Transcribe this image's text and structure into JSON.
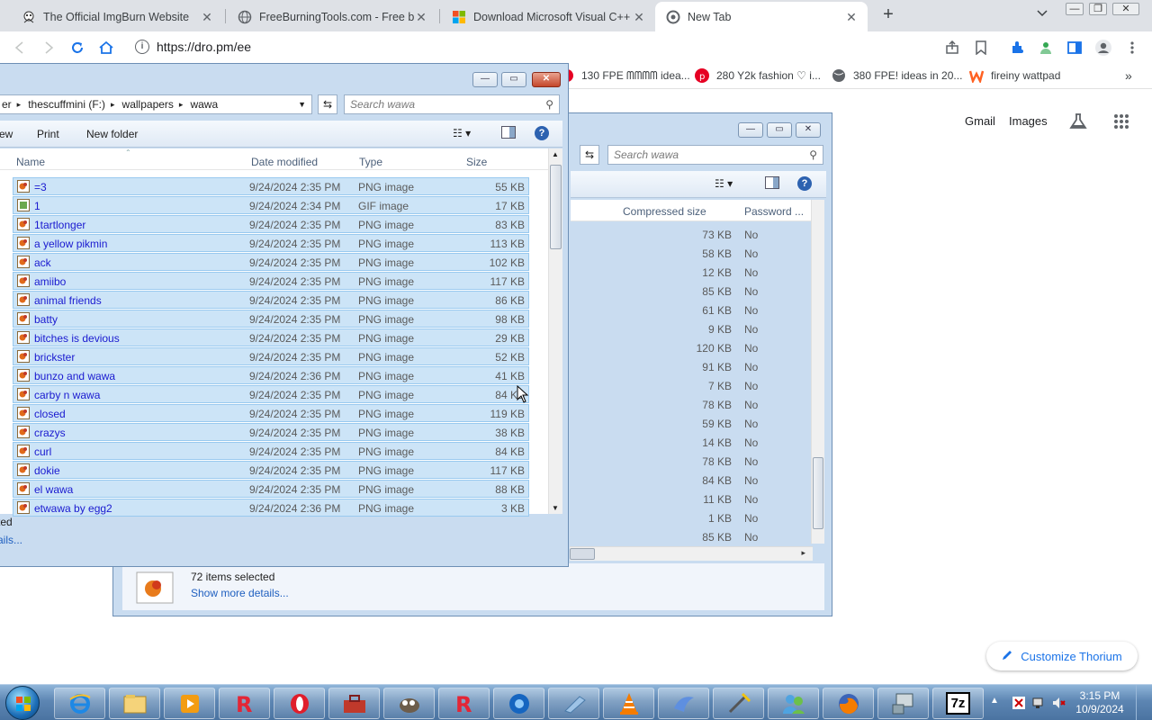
{
  "browser": {
    "tabs": [
      {
        "title": "The Official ImgBurn Website",
        "active": false
      },
      {
        "title": "FreeBurningTools.com - Free bur",
        "active": false
      },
      {
        "title": "Download Microsoft Visual C++",
        "active": false
      },
      {
        "title": "New Tab",
        "active": true
      }
    ],
    "new_tab_label": "+",
    "url": "https://dro.pm/ee",
    "bookmarks": [
      "130 FPE ᗰᗰᗰᗰ idea...",
      "280 Y2k fashion ♡ i...",
      "380 FPE! ideas in 20...",
      "fireiny wattpad"
    ]
  },
  "google": {
    "gmail_label": "Gmail",
    "images_label": "Images",
    "customize_label": "Customize Thorium"
  },
  "explorer_front": {
    "breadcrumb": [
      "er",
      "thescuffmini (F:)",
      "wallpapers",
      "wawa"
    ],
    "search_placeholder": "Search wawa",
    "toolbar": {
      "view_label": "ew",
      "print_label": "Print",
      "new_folder_label": "New folder"
    },
    "columns": {
      "name": "Name",
      "date": "Date modified",
      "type": "Type",
      "size": "Size"
    },
    "rows": [
      {
        "name": "=3",
        "date": "9/24/2024 2:35 PM",
        "type": "PNG image",
        "size": "55 KB"
      },
      {
        "name": "1",
        "date": "9/24/2024 2:34 PM",
        "type": "GIF image",
        "size": "17 KB"
      },
      {
        "name": "1tartlonger",
        "date": "9/24/2024 2:35 PM",
        "type": "PNG image",
        "size": "83 KB"
      },
      {
        "name": "a yellow pikmin",
        "date": "9/24/2024 2:35 PM",
        "type": "PNG image",
        "size": "113 KB"
      },
      {
        "name": "ack",
        "date": "9/24/2024 2:35 PM",
        "type": "PNG image",
        "size": "102 KB"
      },
      {
        "name": "amiibo",
        "date": "9/24/2024 2:35 PM",
        "type": "PNG image",
        "size": "117 KB"
      },
      {
        "name": "animal friends",
        "date": "9/24/2024 2:35 PM",
        "type": "PNG image",
        "size": "86 KB"
      },
      {
        "name": "batty",
        "date": "9/24/2024 2:35 PM",
        "type": "PNG image",
        "size": "98 KB"
      },
      {
        "name": "bitches is devious",
        "date": "9/24/2024 2:35 PM",
        "type": "PNG image",
        "size": "29 KB"
      },
      {
        "name": "brickster",
        "date": "9/24/2024 2:35 PM",
        "type": "PNG image",
        "size": "52 KB"
      },
      {
        "name": "bunzo and wawa",
        "date": "9/24/2024 2:36 PM",
        "type": "PNG image",
        "size": "41 KB"
      },
      {
        "name": "carby n wawa",
        "date": "9/24/2024 2:35 PM",
        "type": "PNG image",
        "size": "84 KB"
      },
      {
        "name": "closed",
        "date": "9/24/2024 2:35 PM",
        "type": "PNG image",
        "size": "119 KB"
      },
      {
        "name": "crazys",
        "date": "9/24/2024 2:35 PM",
        "type": "PNG image",
        "size": "38 KB"
      },
      {
        "name": "curl",
        "date": "9/24/2024 2:35 PM",
        "type": "PNG image",
        "size": "84 KB"
      },
      {
        "name": "dokie",
        "date": "9/24/2024 2:35 PM",
        "type": "PNG image",
        "size": "117 KB"
      },
      {
        "name": "el wawa",
        "date": "9/24/2024 2:35 PM",
        "type": "PNG image",
        "size": "88 KB"
      },
      {
        "name": "etwawa by egg2",
        "date": "9/24/2024 2:36 PM",
        "type": "PNG image",
        "size": "3 KB"
      }
    ],
    "status_partial": "ted",
    "details_partial": "ails..."
  },
  "explorer_back": {
    "search_placeholder": "Search wawa",
    "columns": {
      "compressed": "Compressed size",
      "password": "Password ..."
    },
    "rows": [
      {
        "compressed": "73 KB",
        "password": "No"
      },
      {
        "compressed": "58 KB",
        "password": "No"
      },
      {
        "compressed": "12 KB",
        "password": "No"
      },
      {
        "compressed": "85 KB",
        "password": "No"
      },
      {
        "compressed": "61 KB",
        "password": "No"
      },
      {
        "compressed": "9 KB",
        "password": "No"
      },
      {
        "compressed": "120 KB",
        "password": "No"
      },
      {
        "compressed": "91 KB",
        "password": "No"
      },
      {
        "compressed": "7 KB",
        "password": "No"
      },
      {
        "compressed": "78 KB",
        "password": "No"
      },
      {
        "compressed": "59 KB",
        "password": "No"
      },
      {
        "compressed": "14 KB",
        "password": "No"
      },
      {
        "compressed": "78 KB",
        "password": "No"
      },
      {
        "compressed": "84 KB",
        "password": "No"
      },
      {
        "compressed": "11 KB",
        "password": "No"
      },
      {
        "compressed": "1 KB",
        "password": "No"
      },
      {
        "compressed": "85 KB",
        "password": "No"
      }
    ],
    "status": "72 items selected",
    "details_link": "Show more details..."
  },
  "taskbar": {
    "apps": [
      "internet-explorer-icon",
      "file-explorer-icon",
      "media-player-icon",
      "roblox-icon",
      "opera-icon",
      "toolbox-icon",
      "gimp-icon",
      "roblox-studio-icon",
      "chrome-like-icon",
      "notepad-icon",
      "vlc-icon",
      "bird-app-icon",
      "tool-icon",
      "people-icon",
      "firefox-icon",
      "device-manager-icon",
      "7zip-icon"
    ],
    "clock_time": "3:15 PM",
    "clock_date": "10/9/2024",
    "zip_label": "7z"
  },
  "colors": {
    "selection": "#cce4f7",
    "link": "#1a1ad0",
    "taskbar": "#5d86b3"
  }
}
